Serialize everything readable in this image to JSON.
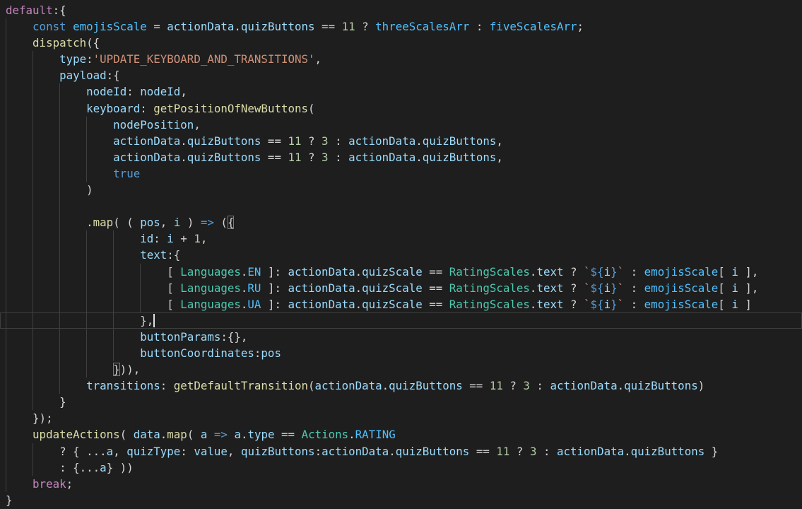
{
  "editor": {
    "description": "VS Code dark-theme editor pane showing a JavaScript switch-case default block",
    "background": "#1e1e1e",
    "colors": {
      "bg": "#1e1e1e",
      "kw1": "#C586C0",
      "kw2": "#569CD6",
      "var": "#9CDCFE",
      "cnst": "#4FC1FF",
      "fn": "#DCDCAA",
      "cls": "#4EC9B0",
      "num": "#B5CEA8",
      "str": "#CE9178",
      "pun": "#D4D4D4",
      "guide": "#404040",
      "cursor": "#e0e0e0",
      "lineBorder": "#3e3e3e",
      "bracketBorder": "#7b7b7b"
    },
    "lines": [
      {
        "spaces": 0,
        "guides": 0,
        "tokens": [
          [
            "kw1",
            "default"
          ],
          [
            "pun",
            ":{"
          ]
        ]
      },
      {
        "spaces": 4,
        "guides": 1,
        "tokens": [
          [
            "kw2",
            "const"
          ],
          [
            "pun",
            " "
          ],
          [
            "cnst",
            "emojisScale"
          ],
          [
            "pun",
            " = "
          ],
          [
            "var",
            "actionData"
          ],
          [
            "pun",
            "."
          ],
          [
            "var",
            "quizButtons"
          ],
          [
            "pun",
            " == "
          ],
          [
            "num",
            "11"
          ],
          [
            "pun",
            " ? "
          ],
          [
            "cnst",
            "threeScalesArr"
          ],
          [
            "pun",
            " : "
          ],
          [
            "cnst",
            "fiveScalesArr"
          ],
          [
            "pun",
            ";"
          ]
        ]
      },
      {
        "spaces": 4,
        "guides": 1,
        "tokens": [
          [
            "fn",
            "dispatch"
          ],
          [
            "pun",
            "({"
          ]
        ]
      },
      {
        "spaces": 8,
        "guides": 2,
        "tokens": [
          [
            "var",
            "type"
          ],
          [
            "pun",
            ":"
          ],
          [
            "str",
            "'UPDATE_KEYBOARD_AND_TRANSITIONS'"
          ],
          [
            "pun",
            ","
          ]
        ]
      },
      {
        "spaces": 8,
        "guides": 2,
        "tokens": [
          [
            "var",
            "payload"
          ],
          [
            "pun",
            ":{"
          ]
        ]
      },
      {
        "spaces": 12,
        "guides": 3,
        "tokens": [
          [
            "var",
            "nodeId"
          ],
          [
            "pun",
            ": "
          ],
          [
            "var",
            "nodeId"
          ],
          [
            "pun",
            ","
          ]
        ]
      },
      {
        "spaces": 12,
        "guides": 3,
        "tokens": [
          [
            "var",
            "keyboard"
          ],
          [
            "pun",
            ": "
          ],
          [
            "fn",
            "getPositionOfNewButtons"
          ],
          [
            "pun",
            "("
          ]
        ]
      },
      {
        "spaces": 16,
        "guides": 4,
        "tokens": [
          [
            "var",
            "nodePosition"
          ],
          [
            "pun",
            ","
          ]
        ]
      },
      {
        "spaces": 16,
        "guides": 4,
        "tokens": [
          [
            "var",
            "actionData"
          ],
          [
            "pun",
            "."
          ],
          [
            "var",
            "quizButtons"
          ],
          [
            "pun",
            " == "
          ],
          [
            "num",
            "11"
          ],
          [
            "pun",
            " ? "
          ],
          [
            "num",
            "3"
          ],
          [
            "pun",
            " : "
          ],
          [
            "var",
            "actionData"
          ],
          [
            "pun",
            "."
          ],
          [
            "var",
            "quizButtons"
          ],
          [
            "pun",
            ","
          ]
        ]
      },
      {
        "spaces": 16,
        "guides": 4,
        "tokens": [
          [
            "var",
            "actionData"
          ],
          [
            "pun",
            "."
          ],
          [
            "var",
            "quizButtons"
          ],
          [
            "pun",
            " == "
          ],
          [
            "num",
            "11"
          ],
          [
            "pun",
            " ? "
          ],
          [
            "num",
            "3"
          ],
          [
            "pun",
            " : "
          ],
          [
            "var",
            "actionData"
          ],
          [
            "pun",
            "."
          ],
          [
            "var",
            "quizButtons"
          ],
          [
            "pun",
            ","
          ]
        ]
      },
      {
        "spaces": 16,
        "guides": 4,
        "tokens": [
          [
            "kw2",
            "true"
          ]
        ]
      },
      {
        "spaces": 12,
        "guides": 3,
        "tokens": [
          [
            "pun",
            ")"
          ]
        ]
      },
      {
        "spaces": 0,
        "guides": 3,
        "tokens": []
      },
      {
        "spaces": 12,
        "guides": 3,
        "tokens": [
          [
            "pun",
            "."
          ],
          [
            "fn",
            "map"
          ],
          [
            "pun",
            "( ( "
          ],
          [
            "var",
            "pos"
          ],
          [
            "pun",
            ", "
          ],
          [
            "var",
            "i"
          ],
          [
            "pun",
            " ) "
          ],
          [
            "kw2",
            "=>"
          ],
          [
            "pun",
            " ("
          ],
          [
            "pun",
            "{",
            "box"
          ]
        ]
      },
      {
        "spaces": 20,
        "guides": 5,
        "tokens": [
          [
            "var",
            "id"
          ],
          [
            "pun",
            ": "
          ],
          [
            "var",
            "i"
          ],
          [
            "pun",
            " + "
          ],
          [
            "num",
            "1"
          ],
          [
            "pun",
            ","
          ]
        ]
      },
      {
        "spaces": 20,
        "guides": 5,
        "tokens": [
          [
            "var",
            "text"
          ],
          [
            "pun",
            ":{"
          ]
        ]
      },
      {
        "spaces": 24,
        "guides": 6,
        "tokens": [
          [
            "pun",
            "[ "
          ],
          [
            "cls",
            "Languages"
          ],
          [
            "pun",
            "."
          ],
          [
            "cnst",
            "EN"
          ],
          [
            "pun",
            " ]: "
          ],
          [
            "var",
            "actionData"
          ],
          [
            "pun",
            "."
          ],
          [
            "var",
            "quizScale"
          ],
          [
            "pun",
            " == "
          ],
          [
            "cls",
            "RatingScales"
          ],
          [
            "pun",
            "."
          ],
          [
            "var",
            "text"
          ],
          [
            "pun",
            " ? "
          ],
          [
            "str",
            "`"
          ],
          [
            "kw2",
            "${"
          ],
          [
            "var",
            "i"
          ],
          [
            "kw2",
            "}"
          ],
          [
            "str",
            "`"
          ],
          [
            "pun",
            " : "
          ],
          [
            "cnst",
            "emojisScale"
          ],
          [
            "pun",
            "[ "
          ],
          [
            "var",
            "i"
          ],
          [
            "pun",
            " ],"
          ]
        ]
      },
      {
        "spaces": 24,
        "guides": 6,
        "tokens": [
          [
            "pun",
            "[ "
          ],
          [
            "cls",
            "Languages"
          ],
          [
            "pun",
            "."
          ],
          [
            "cnst",
            "RU"
          ],
          [
            "pun",
            " ]: "
          ],
          [
            "var",
            "actionData"
          ],
          [
            "pun",
            "."
          ],
          [
            "var",
            "quizScale"
          ],
          [
            "pun",
            " == "
          ],
          [
            "cls",
            "RatingScales"
          ],
          [
            "pun",
            "."
          ],
          [
            "var",
            "text"
          ],
          [
            "pun",
            " ? "
          ],
          [
            "str",
            "`"
          ],
          [
            "kw2",
            "${"
          ],
          [
            "var",
            "i"
          ],
          [
            "kw2",
            "}"
          ],
          [
            "str",
            "`"
          ],
          [
            "pun",
            " : "
          ],
          [
            "cnst",
            "emojisScale"
          ],
          [
            "pun",
            "[ "
          ],
          [
            "var",
            "i"
          ],
          [
            "pun",
            " ],"
          ]
        ]
      },
      {
        "spaces": 24,
        "guides": 6,
        "tokens": [
          [
            "pun",
            "[ "
          ],
          [
            "cls",
            "Languages"
          ],
          [
            "pun",
            "."
          ],
          [
            "cnst",
            "UA"
          ],
          [
            "pun",
            " ]: "
          ],
          [
            "var",
            "actionData"
          ],
          [
            "pun",
            "."
          ],
          [
            "var",
            "quizScale"
          ],
          [
            "pun",
            " == "
          ],
          [
            "cls",
            "RatingScales"
          ],
          [
            "pun",
            "."
          ],
          [
            "var",
            "text"
          ],
          [
            "pun",
            " ? "
          ],
          [
            "str",
            "`"
          ],
          [
            "kw2",
            "${"
          ],
          [
            "var",
            "i"
          ],
          [
            "kw2",
            "}"
          ],
          [
            "str",
            "`"
          ],
          [
            "pun",
            " : "
          ],
          [
            "cnst",
            "emojisScale"
          ],
          [
            "pun",
            "[ "
          ],
          [
            "var",
            "i"
          ],
          [
            "pun",
            " ]"
          ]
        ]
      },
      {
        "spaces": 20,
        "guides": 5,
        "current": true,
        "cursor": true,
        "tokens": [
          [
            "pun",
            "},"
          ]
        ]
      },
      {
        "spaces": 20,
        "guides": 5,
        "tokens": [
          [
            "var",
            "buttonParams"
          ],
          [
            "pun",
            ":{},"
          ]
        ]
      },
      {
        "spaces": 20,
        "guides": 5,
        "tokens": [
          [
            "var",
            "buttonCoordinates"
          ],
          [
            "pun",
            ":"
          ],
          [
            "var",
            "pos"
          ]
        ]
      },
      {
        "spaces": 16,
        "guides": 4,
        "tokens": [
          [
            "pun",
            "}",
            "box"
          ],
          [
            "pun",
            ")),"
          ]
        ]
      },
      {
        "spaces": 12,
        "guides": 3,
        "tokens": [
          [
            "var",
            "transitions"
          ],
          [
            "pun",
            ": "
          ],
          [
            "fn",
            "getDefaultTransition"
          ],
          [
            "pun",
            "("
          ],
          [
            "var",
            "actionData"
          ],
          [
            "pun",
            "."
          ],
          [
            "var",
            "quizButtons"
          ],
          [
            "pun",
            " == "
          ],
          [
            "num",
            "11"
          ],
          [
            "pun",
            " ? "
          ],
          [
            "num",
            "3"
          ],
          [
            "pun",
            " : "
          ],
          [
            "var",
            "actionData"
          ],
          [
            "pun",
            "."
          ],
          [
            "var",
            "quizButtons"
          ],
          [
            "pun",
            ")"
          ]
        ]
      },
      {
        "spaces": 8,
        "guides": 2,
        "tokens": [
          [
            "pun",
            "}"
          ]
        ]
      },
      {
        "spaces": 4,
        "guides": 1,
        "tokens": [
          [
            "pun",
            "});"
          ]
        ]
      },
      {
        "spaces": 4,
        "guides": 1,
        "tokens": [
          [
            "fn",
            "updateActions"
          ],
          [
            "pun",
            "( "
          ],
          [
            "var",
            "data"
          ],
          [
            "pun",
            "."
          ],
          [
            "fn",
            "map"
          ],
          [
            "pun",
            "( "
          ],
          [
            "var",
            "a"
          ],
          [
            "pun",
            " "
          ],
          [
            "kw2",
            "=>"
          ],
          [
            "pun",
            " "
          ],
          [
            "var",
            "a"
          ],
          [
            "pun",
            "."
          ],
          [
            "var",
            "type"
          ],
          [
            "pun",
            " == "
          ],
          [
            "cls",
            "Actions"
          ],
          [
            "pun",
            "."
          ],
          [
            "cnst",
            "RATING"
          ]
        ]
      },
      {
        "spaces": 8,
        "guides": 2,
        "tokens": [
          [
            "pun",
            "? { ..."
          ],
          [
            "var",
            "a"
          ],
          [
            "pun",
            ", "
          ],
          [
            "var",
            "quizType"
          ],
          [
            "pun",
            ": "
          ],
          [
            "var",
            "value"
          ],
          [
            "pun",
            ", "
          ],
          [
            "var",
            "quizButtons"
          ],
          [
            "pun",
            ":"
          ],
          [
            "var",
            "actionData"
          ],
          [
            "pun",
            "."
          ],
          [
            "var",
            "quizButtons"
          ],
          [
            "pun",
            " == "
          ],
          [
            "num",
            "11"
          ],
          [
            "pun",
            " ? "
          ],
          [
            "num",
            "3"
          ],
          [
            "pun",
            " : "
          ],
          [
            "var",
            "actionData"
          ],
          [
            "pun",
            "."
          ],
          [
            "var",
            "quizButtons"
          ],
          [
            "pun",
            " }"
          ]
        ]
      },
      {
        "spaces": 8,
        "guides": 2,
        "tokens": [
          [
            "pun",
            ": {..."
          ],
          [
            "var",
            "a"
          ],
          [
            "pun",
            "} ))"
          ]
        ]
      },
      {
        "spaces": 4,
        "guides": 1,
        "tokens": [
          [
            "kw1",
            "break"
          ],
          [
            "pun",
            ";"
          ]
        ]
      },
      {
        "spaces": 0,
        "guides": 0,
        "tokens": [
          [
            "pun",
            "}"
          ]
        ]
      }
    ]
  }
}
